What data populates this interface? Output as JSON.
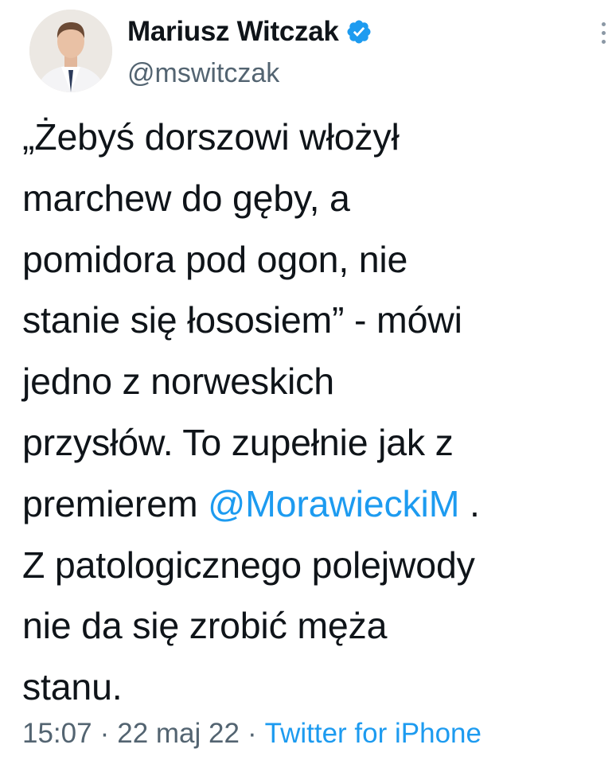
{
  "author": {
    "display_name": "Mariusz Witczak",
    "handle": "@mswitczak",
    "verified_icon": "verified-badge-icon"
  },
  "tweet": {
    "lines": [
      "„Żebyś dorszowi włożył",
      "marchew do gęby, a",
      "pomidora pod ogon, nie",
      "stanie się łososiem” - mówi",
      "jedno z norweskich",
      "przysłów. To zupełnie jak z"
    ],
    "line7_prefix": "premierem ",
    "mention": "@MorawieckiM",
    "line7_suffix": " .",
    "lines_after": [
      "Z patologicznego polejwody",
      "nie da się zrobić męża",
      "stanu."
    ]
  },
  "meta": {
    "time": "15:07",
    "separator": "·",
    "date": "22 maj 22",
    "source": "Twitter for iPhone"
  },
  "colors": {
    "accent": "#1d9bf0",
    "text": "#0f1419",
    "secondary": "#536471"
  }
}
